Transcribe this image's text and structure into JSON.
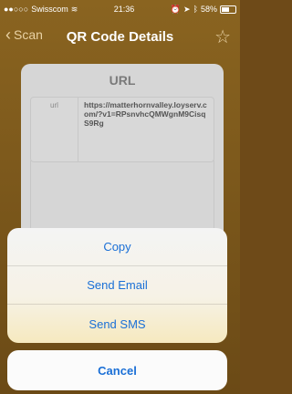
{
  "status_bar": {
    "carrier": "Swisscom",
    "time": "21:36",
    "battery_percent": "58%"
  },
  "nav": {
    "back_label": "Scan",
    "title": "QR Code Details"
  },
  "card": {
    "title": "URL",
    "row_key": "url",
    "row_value": "https://matterhornvalley.loyserv.com/?v1=RPsnvhcQMWgnM9CisqS9Rg"
  },
  "action_sheet": {
    "copy_label": "Copy",
    "email_label": "Send Email",
    "sms_label": "Send SMS",
    "cancel_label": "Cancel"
  },
  "colors": {
    "accent": "#1a6fd6",
    "nav_background": "#7a5a1e"
  }
}
